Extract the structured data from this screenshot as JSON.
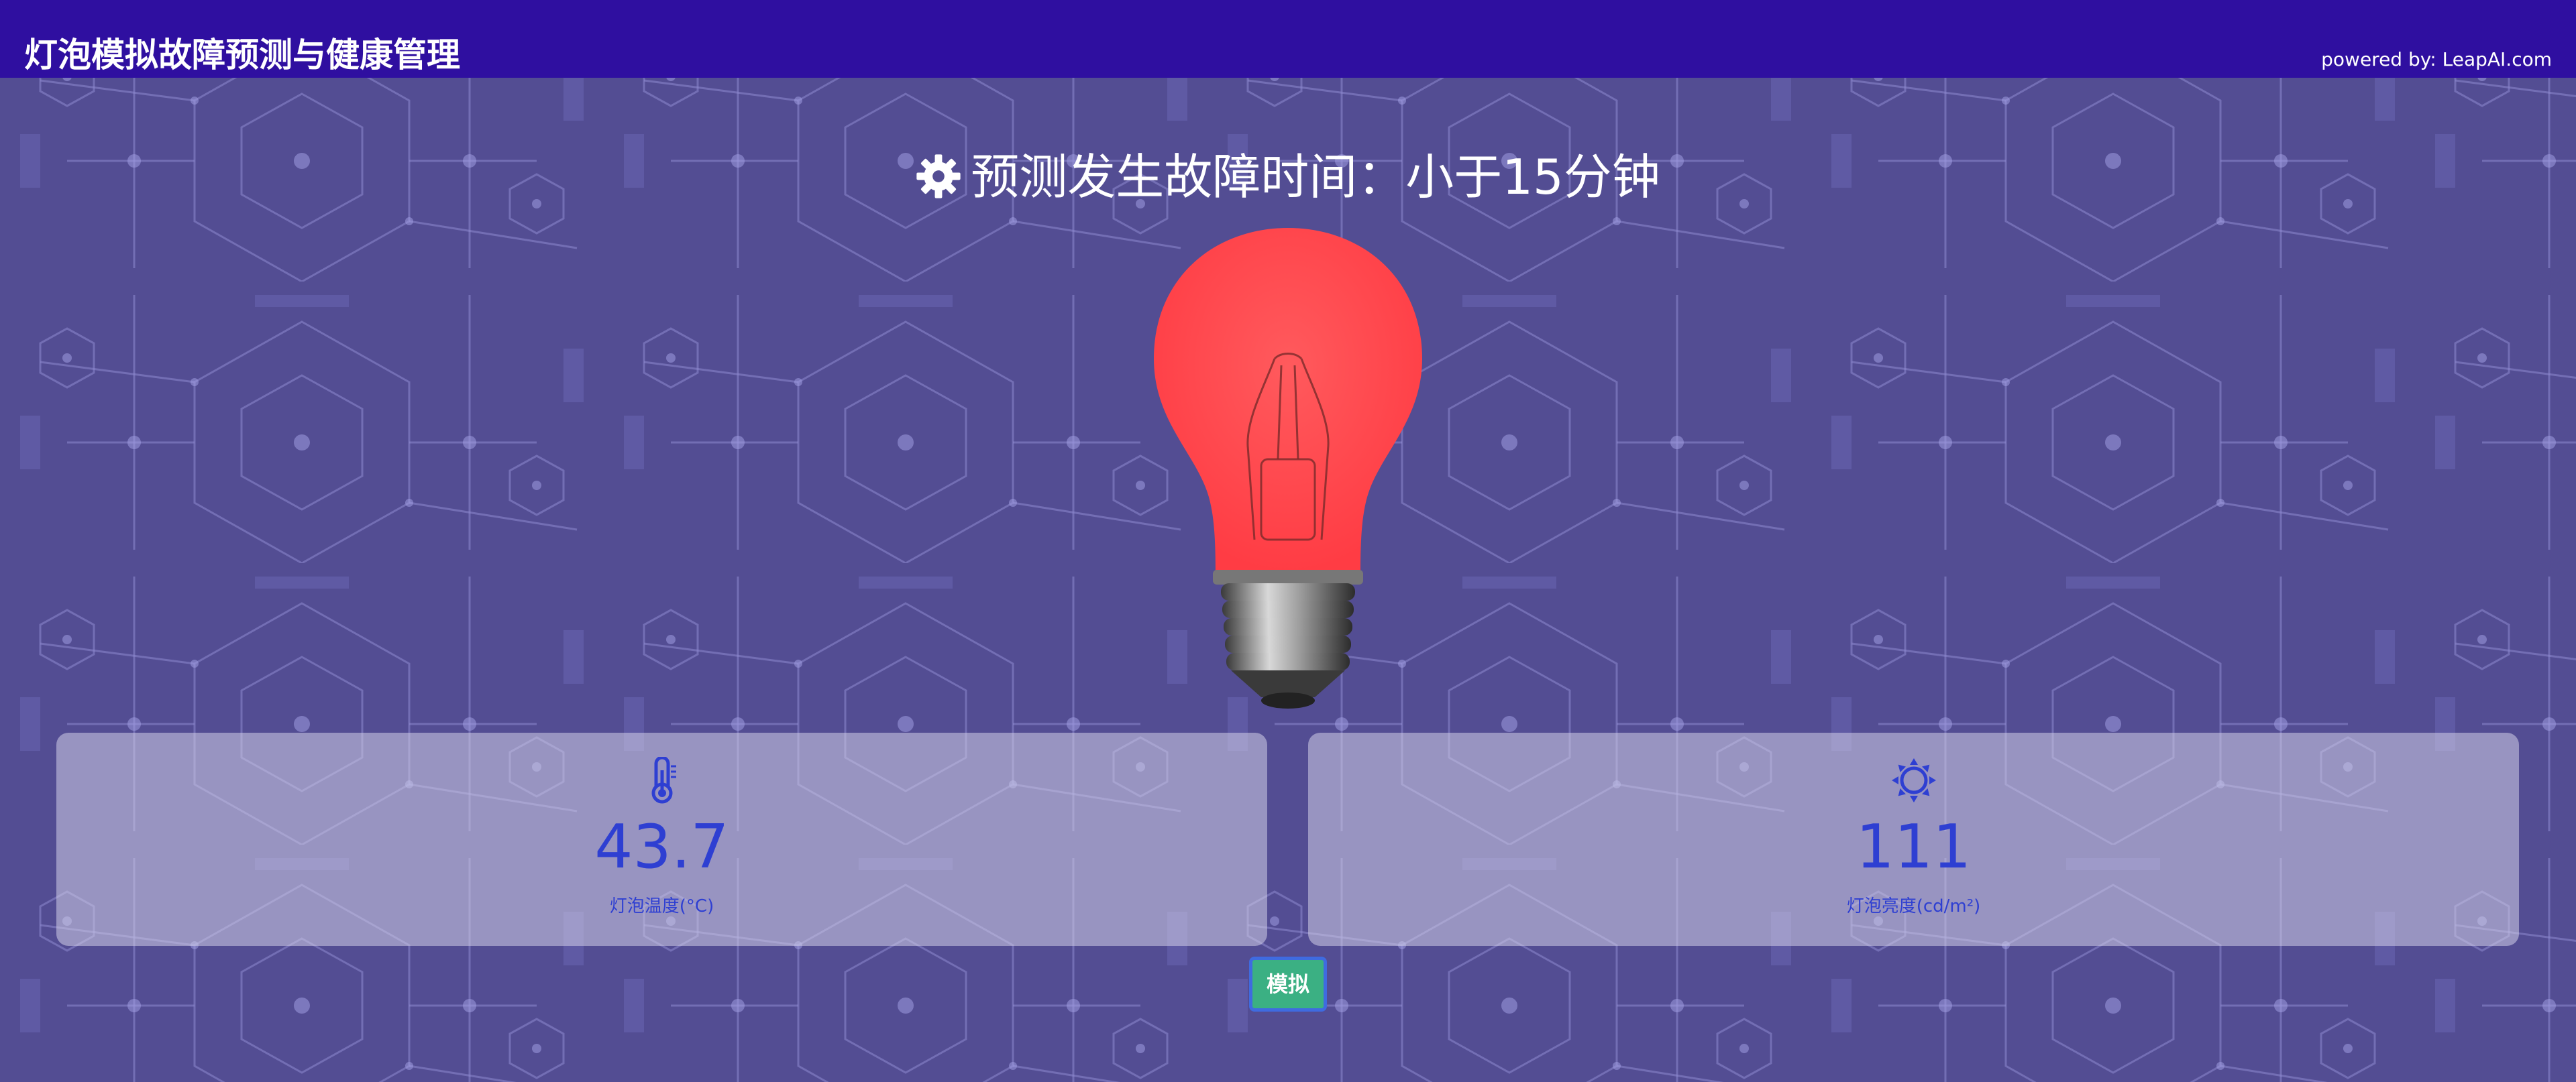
{
  "header": {
    "title": "灯泡模拟故障预测与健康管理",
    "powered_by": "powered by: LeapAI.com"
  },
  "prediction": {
    "icon": "gear-icon",
    "text": "预测发生故障时间：小于15分钟"
  },
  "bulb": {
    "icon": "light-bulb-image",
    "color": "#ff4a4e"
  },
  "cards": {
    "temperature": {
      "icon": "thermometer-icon",
      "value": "43.7",
      "label": "灯泡温度(°C)"
    },
    "brightness": {
      "icon": "sun-icon",
      "value": "111",
      "label": "灯泡亮度(cd/m²)"
    }
  },
  "actions": {
    "simulate_label": "模拟"
  },
  "colors": {
    "topbar": "#2f0fa0",
    "background": "#534d93",
    "value_text": "#2e3fd2",
    "button": "#3bb083"
  }
}
